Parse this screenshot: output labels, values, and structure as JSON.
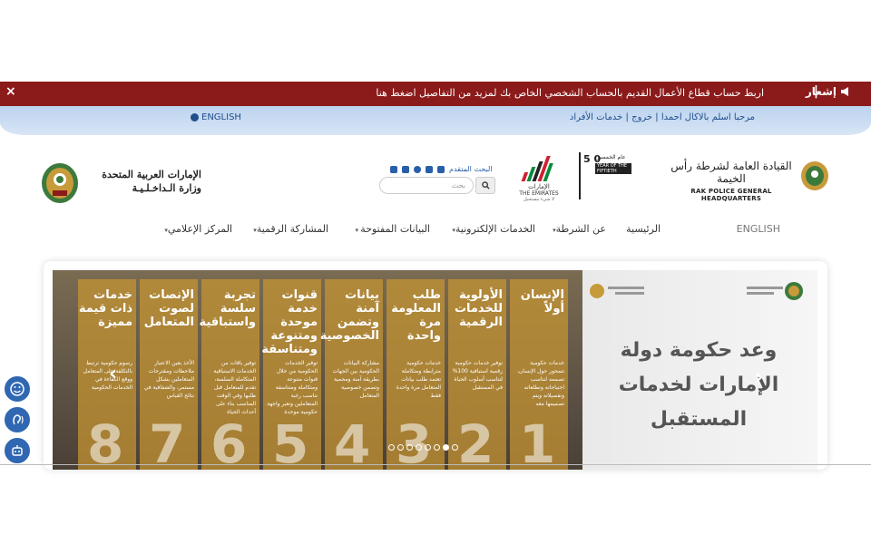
{
  "notice": {
    "label": "إشعار",
    "message": "اربط حساب قطاع الأعمال القديم بالحساب الشخصي الخاص بك لمزيد من التفاصيل اضغط هنا",
    "close": "×"
  },
  "user_strip": {
    "welcome": "مرحبا اسلم بالاكال احمدا",
    "logout": "خروج",
    "services": "خدمات الأفراد",
    "sep": "|",
    "english": "ENGLISH"
  },
  "header": {
    "moi_line1": "الإمارات العربية المتحدة",
    "moi_line2": "وزارة الـداخـلـيـة",
    "advanced_search": "البحث المتقدم",
    "search_placeholder": "بحث",
    "emirates_ar": "الإمارات",
    "emirates_en": "THE EMIRATES",
    "emirates_sub": "لا شيء مستحيل",
    "fifty_num": "5 0",
    "fifty_t1": "عام الخمسين",
    "fifty_t2": "YEAR OF THE FIFTIETH",
    "rak_ar": "القيادة العامة لشرطة رأس الخيمة",
    "rak_en": "RAK POLICE GENERAL HEADQUARTERS"
  },
  "nav": {
    "english": "ENGLISH",
    "items": [
      "الرئيسية",
      "عن الشرطة",
      "الخدمات الإلكترونية",
      "البيانات المفتوحة",
      "المشاركة الرقمية",
      "المركز الإعلامي"
    ]
  },
  "slider": {
    "promise_text": "وعد حكومة دولة الإمارات لخدمات المستقبل",
    "arrow_prev": "‹",
    "arrow_next": "›",
    "panels": [
      {
        "title": "الإنسان أولاً",
        "desc": "خدمات حكومية تتمحور حول الإنسان، تصممه لتناسب احتياجاته وتطلعاته وتفصيلاته ويتم تصميمها معه",
        "num": "1"
      },
      {
        "title": "الأولوية للخدمات الرقمية",
        "desc": "توفير خدمات حكومية رقمية استباقية 100% لتناسب أسلوب الحياة في المستقبل",
        "num": "2"
      },
      {
        "title": "طلب المعلومة مرة واحدة",
        "desc": "خدمات حكومية مترابطة ومتكاملة تعتمد طلب بيانات المتعامل مرة واحدة فقط",
        "num": "3"
      },
      {
        "title": "بيانات آمنة وتضمن الخصوصية",
        "desc": "مشاركة البيانات الحكومية بين الجهات بطريقة آمنة ومحمية وتضمن خصوصية المتعامل",
        "num": "4"
      },
      {
        "title": "قنوات خدمة موحدة ومتنوعة ومتناسقة",
        "desc": "توفير الخدمات الحكومية من خلال قنوات متنوعة ومتكاملة ومتناسقة تناسب رغبة المتعاملين وتعبر واجهة حكومية موحدة",
        "num": "5"
      },
      {
        "title": "تجربة سلسة واستباقية",
        "desc": "توفير باقات من الخدمات الاستباقية المتكاملة السلسة، تقدم للمتعامل قبل طلبها وفي الوقت المناسب بناء على أحداث الحياة",
        "num": "6"
      },
      {
        "title": "الإنصات لصوت المتعامل",
        "desc": "الأخذ بعين الاعتبار ملاحظات ومقترحات المتعاملين بشكل مستمر، والشفافية في نتائج القياس",
        "num": "7"
      },
      {
        "title": "خدمات ذات قيمة مميزة",
        "desc": "رسوم حكومية ترتبط بالتكلفة على المتعامل ووقع الكفاءة في الخدمات الحكومية",
        "num": "8"
      }
    ]
  },
  "colors": {
    "notice_bg": "#8b1a1a",
    "strip": "#bcd3ef",
    "link": "#1f4e8c",
    "panel_gold": "#c89632",
    "side_btn": "#2f67b2"
  },
  "icons": [
    "megaphone-icon",
    "close-icon",
    "globe-icon",
    "search-icon",
    "sitemap-icon",
    "settings-icon",
    "help-icon",
    "print-icon",
    "rss-icon",
    "smile-icon",
    "hearing-icon",
    "robot-icon"
  ]
}
